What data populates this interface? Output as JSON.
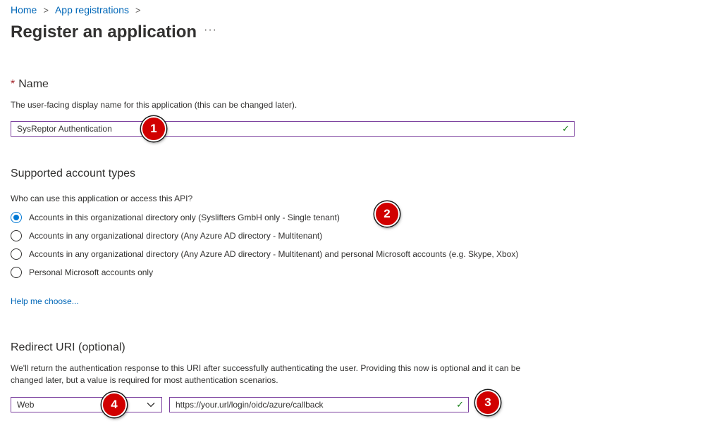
{
  "breadcrumb": {
    "home": "Home",
    "app_registrations": "App registrations",
    "separator": ">"
  },
  "page": {
    "title": "Register an application",
    "more": "···"
  },
  "name_section": {
    "required_marker": "*",
    "heading": "Name",
    "description": "The user-facing display name for this application (this can be changed later).",
    "value": "SysReptor Authentication",
    "check": "✓"
  },
  "account_types": {
    "heading": "Supported account types",
    "question": "Who can use this application or access this API?",
    "options": [
      {
        "label": "Accounts in this organizational directory only (Syslifters GmbH only - Single tenant)",
        "selected": true
      },
      {
        "label": "Accounts in any organizational directory (Any Azure AD directory - Multitenant)",
        "selected": false
      },
      {
        "label": "Accounts in any organizational directory (Any Azure AD directory - Multitenant) and personal Microsoft accounts (e.g. Skype, Xbox)",
        "selected": false
      },
      {
        "label": "Personal Microsoft accounts only",
        "selected": false
      }
    ],
    "help_link": "Help me choose..."
  },
  "redirect": {
    "heading": "Redirect URI (optional)",
    "description_line1": "We'll return the authentication response to this URI after successfully authenticating the user. Providing this now is optional and it can be",
    "description_line2": "changed later, but a value is required for most authentication scenarios.",
    "platform": "Web",
    "uri": "https://your.url/login/oidc/azure/callback",
    "check": "✓"
  },
  "badges": [
    "1",
    "2",
    "3",
    "4"
  ],
  "colors": {
    "link": "#0067b8",
    "accent": "#0078d4",
    "field_border": "#7a3e9d",
    "badge": "#d10000",
    "check": "#107c10"
  }
}
